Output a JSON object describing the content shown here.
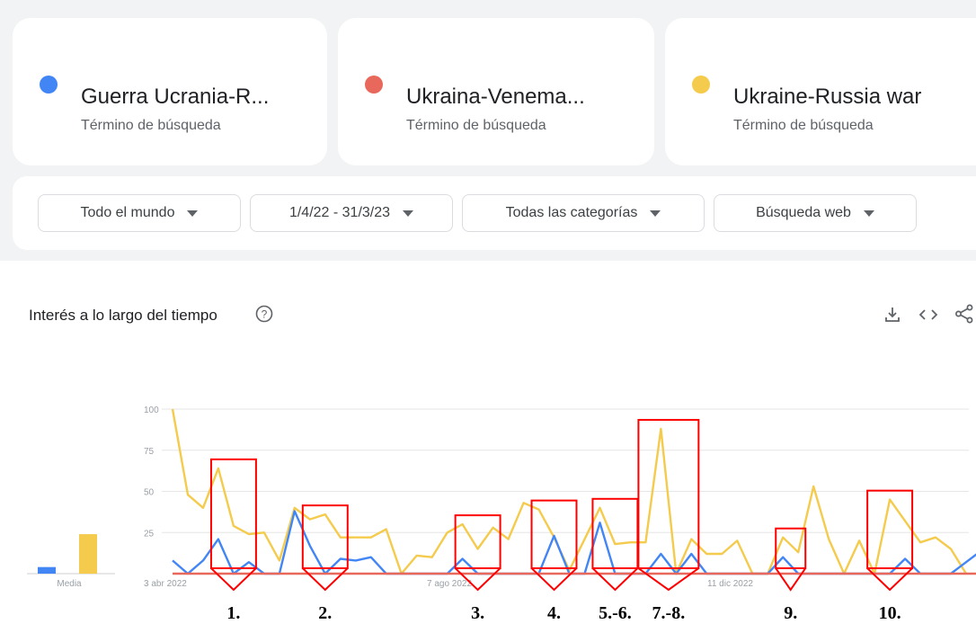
{
  "search_terms": [
    {
      "name": "Guerra Ucrania-R...",
      "subtitle": "Término de búsqueda",
      "color": "#4285f4"
    },
    {
      "name": "Ukraina-Venema...",
      "subtitle": "Término de búsqueda",
      "color": "#e8685b"
    },
    {
      "name": "Ukraine-Russia war",
      "subtitle": "Término de búsqueda",
      "color": "#f4cb4c"
    }
  ],
  "filters": {
    "region": "Todo el mundo",
    "date_range": "1/4/22 - 31/3/23",
    "category": "Todas las categorías",
    "search_type": "Búsqueda web"
  },
  "section": {
    "title": "Interés a lo largo del tiempo"
  },
  "icons": {
    "help": "help-circle-icon",
    "download": "download-icon",
    "embed": "embed-code-icon",
    "share": "share-icon"
  },
  "chart_data": {
    "type": "line",
    "ylim": [
      0,
      100
    ],
    "y_ticks": [
      25,
      50,
      75,
      100
    ],
    "x_tick_labels": [
      "3 abr 2022",
      "7 ago 2022",
      "11 dic 2022"
    ],
    "average_label": "Media",
    "average_values": [
      {
        "series": "Guerra Ucrania-R...",
        "value": 4
      },
      {
        "series": "Ukraine-Russia war",
        "value": 24
      }
    ],
    "series": [
      {
        "name": "Ukraine-Russia war",
        "color": "#f4cb4c",
        "values": [
          100,
          48,
          40,
          64,
          29,
          24,
          25,
          8,
          40,
          33,
          36,
          22,
          22,
          22,
          27,
          0,
          11,
          10,
          25,
          30,
          15,
          28,
          21,
          43,
          39,
          22,
          2,
          21,
          40,
          18,
          19,
          19,
          88,
          0,
          21,
          12,
          12,
          20,
          0,
          0,
          22,
          13,
          53,
          21,
          0,
          20,
          0,
          45,
          32,
          19,
          22,
          15,
          0
        ]
      },
      {
        "name": "Guerra Ucrania-R...",
        "color": "#4285f4",
        "values": [
          8,
          0,
          8,
          21,
          0,
          7,
          0,
          0,
          38,
          17,
          0,
          9,
          8,
          10,
          0,
          0,
          0,
          0,
          0,
          9,
          0,
          0,
          0,
          0,
          0,
          23,
          0,
          0,
          31,
          0,
          0,
          0,
          12,
          0,
          12,
          0,
          0,
          0,
          0,
          0,
          10,
          0,
          0,
          0,
          0,
          0,
          0,
          0,
          9,
          0,
          0,
          0,
          7,
          14
        ]
      },
      {
        "name": "Ukraina-Venema...",
        "color": "#e8685b",
        "values": [
          0,
          0,
          0,
          0,
          0,
          0,
          0,
          0,
          0,
          0,
          0,
          0,
          0,
          0,
          0,
          0,
          0,
          0,
          0,
          0,
          0,
          0,
          0,
          0,
          0,
          0,
          0,
          0,
          0,
          0,
          0,
          0,
          0,
          0,
          0,
          0,
          0,
          0,
          0,
          0,
          0,
          0,
          0,
          0,
          0,
          0,
          0,
          0,
          0,
          0,
          0,
          0,
          0,
          0
        ]
      }
    ],
    "annotations": [
      {
        "label": "1.",
        "from": 3,
        "to": 5
      },
      {
        "label": "2.",
        "from": 9,
        "to": 11
      },
      {
        "label": "3.",
        "from": 19,
        "to": 21
      },
      {
        "label": "4.",
        "from": 24,
        "to": 26
      },
      {
        "label": "5.-6.",
        "from": 28,
        "to": 30
      },
      {
        "label": "7.-8.",
        "from": 31,
        "to": 34
      },
      {
        "label": "9.",
        "from": 40,
        "to": 41
      },
      {
        "label": "10.",
        "from": 46,
        "to": 48
      }
    ]
  }
}
